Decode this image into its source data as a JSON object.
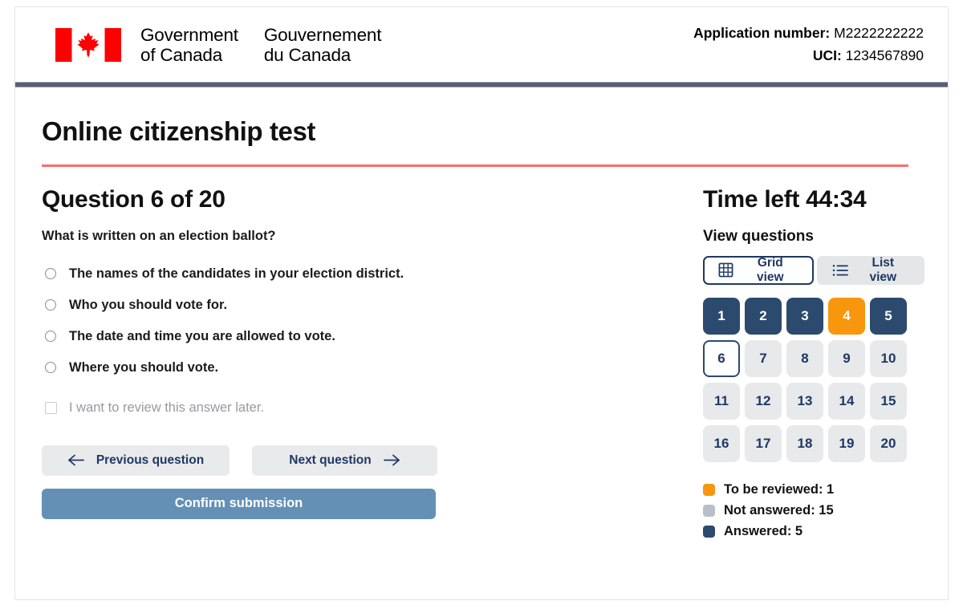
{
  "header": {
    "flag_alt": "canada-flag",
    "wordmark_en": "Government\nof Canada",
    "wordmark_fr": "Gouvernement\ndu Canada",
    "application_number_label": "Application number:",
    "application_number_value": "M2222222222",
    "uci_label": "UCI:",
    "uci_value": "1234567890"
  },
  "page_title": "Online citizenship test",
  "question": {
    "heading": "Question 6 of 20",
    "number": 6,
    "total": 20,
    "text": "What is written on an election ballot?",
    "options": [
      {
        "label": "The names of the candidates in your election district.",
        "selected": false
      },
      {
        "label": "Who you should vote for.",
        "selected": false
      },
      {
        "label": "The date and time you are allowed to vote.",
        "selected": false
      },
      {
        "label": "Where you should vote.",
        "selected": false
      }
    ],
    "review_later_label": "I want to review this answer later.",
    "review_later_checked": false
  },
  "actions": {
    "previous_label": "Previous question",
    "next_label": "Next question",
    "confirm_label": "Confirm submission"
  },
  "sidebar": {
    "time_left_label": "Time left 44:34",
    "time_left_value": "44:34",
    "view_questions_label": "View questions",
    "grid_view_label": "Grid view",
    "list_view_label": "List view",
    "active_view": "grid",
    "tiles": [
      {
        "number": "1",
        "state": "answered"
      },
      {
        "number": "2",
        "state": "answered"
      },
      {
        "number": "3",
        "state": "answered"
      },
      {
        "number": "4",
        "state": "review"
      },
      {
        "number": "5",
        "state": "answered"
      },
      {
        "number": "6",
        "state": "current"
      },
      {
        "number": "7",
        "state": "empty"
      },
      {
        "number": "8",
        "state": "empty"
      },
      {
        "number": "9",
        "state": "empty"
      },
      {
        "number": "10",
        "state": "empty"
      },
      {
        "number": "11",
        "state": "empty"
      },
      {
        "number": "12",
        "state": "empty"
      },
      {
        "number": "13",
        "state": "empty"
      },
      {
        "number": "14",
        "state": "empty"
      },
      {
        "number": "15",
        "state": "empty"
      },
      {
        "number": "16",
        "state": "empty"
      },
      {
        "number": "17",
        "state": "empty"
      },
      {
        "number": "18",
        "state": "empty"
      },
      {
        "number": "19",
        "state": "empty"
      },
      {
        "number": "20",
        "state": "empty"
      }
    ],
    "legend": [
      {
        "label": "To be reviewed: 1",
        "color": "#f8960d"
      },
      {
        "label": "Not answered: 15",
        "color": "#b9bfc9"
      },
      {
        "label": "Answered: 5",
        "color": "#2c4a6e"
      }
    ]
  },
  "colors": {
    "answered": "#2c4a6e",
    "review": "#f8960d",
    "not_answered": "#e7e9eb",
    "accent_red": "#fa6c6c",
    "header_rule": "#565f73",
    "confirm_button": "#6490b5",
    "flag_red": "#ff0000"
  }
}
